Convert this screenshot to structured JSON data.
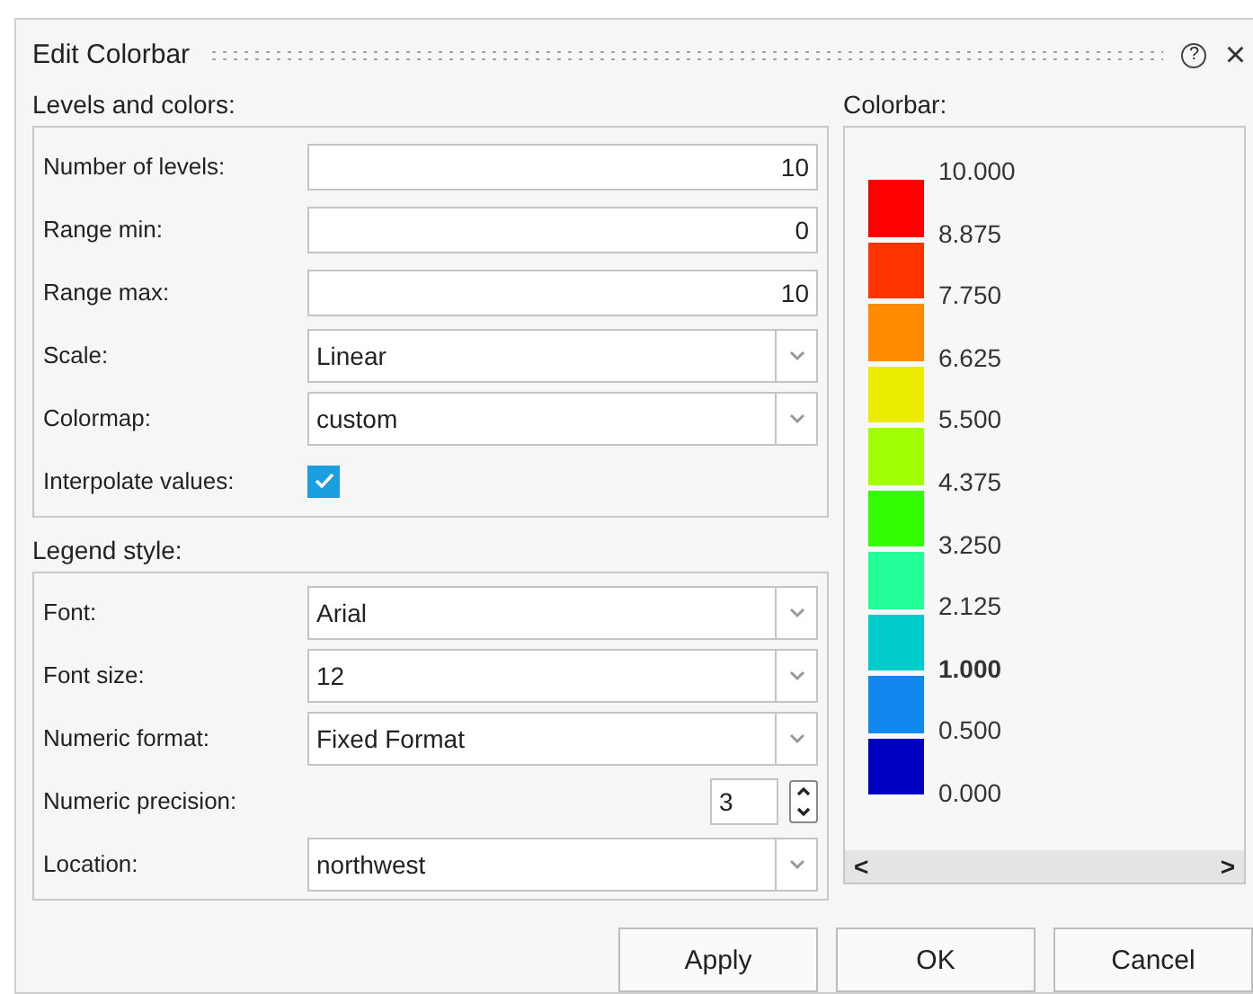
{
  "window": {
    "title": "Edit Colorbar",
    "help": "?",
    "close": "×"
  },
  "levels_section": {
    "title": "Levels and colors:",
    "rows": [
      {
        "kind": "text",
        "label": "Number of levels:",
        "value": "10"
      },
      {
        "kind": "text",
        "label": "Range min:",
        "value": "0"
      },
      {
        "kind": "text",
        "label": "Range max:",
        "value": "10"
      },
      {
        "kind": "combo",
        "label": "Scale:",
        "value": "Linear"
      },
      {
        "kind": "combo",
        "label": "Colormap:",
        "value": "custom"
      },
      {
        "kind": "check",
        "label": "Interpolate values:",
        "checked": true
      }
    ]
  },
  "legend_section": {
    "title": "Legend style:",
    "rows": [
      {
        "kind": "combo",
        "label": "Font:",
        "value": "Arial"
      },
      {
        "kind": "combo",
        "label": "Font size:",
        "value": "12"
      },
      {
        "kind": "combo",
        "label": "Numeric format:",
        "value": "Fixed Format"
      },
      {
        "kind": "spin",
        "label": "Numeric precision:",
        "value": "3"
      },
      {
        "kind": "combo",
        "label": "Location:",
        "value": "northwest"
      }
    ]
  },
  "colorbar": {
    "title": "Colorbar:",
    "swatches": [
      {
        "color": "#ff0000"
      },
      {
        "color": "#ff3300"
      },
      {
        "color": "#ff8c00"
      },
      {
        "color": "#ecec00"
      },
      {
        "color": "#a0ff00"
      },
      {
        "color": "#33ff00"
      },
      {
        "color": "#22ff99"
      },
      {
        "color": "#00cccc"
      },
      {
        "color": "#1188ee"
      },
      {
        "color": "#0000c0"
      }
    ],
    "labels": [
      {
        "text": "10.000",
        "emphasized": false
      },
      {
        "text": "8.875",
        "emphasized": false
      },
      {
        "text": "7.750",
        "emphasized": false
      },
      {
        "text": "6.625",
        "emphasized": false
      },
      {
        "text": "5.500",
        "emphasized": false
      },
      {
        "text": "4.375",
        "emphasized": false
      },
      {
        "text": "3.250",
        "emphasized": false
      },
      {
        "text": "2.125",
        "emphasized": false
      },
      {
        "text": "1.000",
        "emphasized": true
      },
      {
        "text": "0.500",
        "emphasized": false
      },
      {
        "text": "0.000",
        "emphasized": false
      }
    ],
    "scroll_left": "<",
    "scroll_right": ">"
  },
  "buttons": [
    "Apply",
    "OK",
    "Cancel"
  ]
}
